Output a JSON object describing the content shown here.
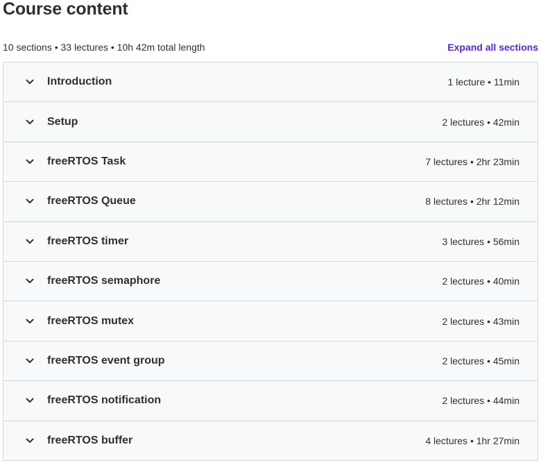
{
  "header": {
    "title": "Course content",
    "summary": "10 sections • 33 lectures • 10h 42m total length",
    "expand_all_label": "Expand all sections"
  },
  "icons": {
    "section_toggle": "chevron-down-icon"
  },
  "colors": {
    "accent": "#5624d0",
    "row_background": "#f7f9fa",
    "border": "#d1d7dc",
    "text": "#2d2f31"
  },
  "sections": [
    {
      "title": "Introduction",
      "meta": "1 lecture • 11min"
    },
    {
      "title": "Setup",
      "meta": "2 lectures • 42min"
    },
    {
      "title": "freeRTOS Task",
      "meta": "7 lectures • 2hr 23min"
    },
    {
      "title": "freeRTOS Queue",
      "meta": "8 lectures • 2hr 12min"
    },
    {
      "title": "freeRTOS timer",
      "meta": "3 lectures • 56min"
    },
    {
      "title": "freeRTOS semaphore",
      "meta": "2 lectures • 40min"
    },
    {
      "title": "freeRTOS mutex",
      "meta": "2 lectures • 43min"
    },
    {
      "title": "freeRTOS event group",
      "meta": "2 lectures • 45min"
    },
    {
      "title": "freeRTOS notification",
      "meta": "2 lectures • 44min"
    },
    {
      "title": "freeRTOS buffer",
      "meta": "4 lectures • 1hr 27min"
    }
  ]
}
